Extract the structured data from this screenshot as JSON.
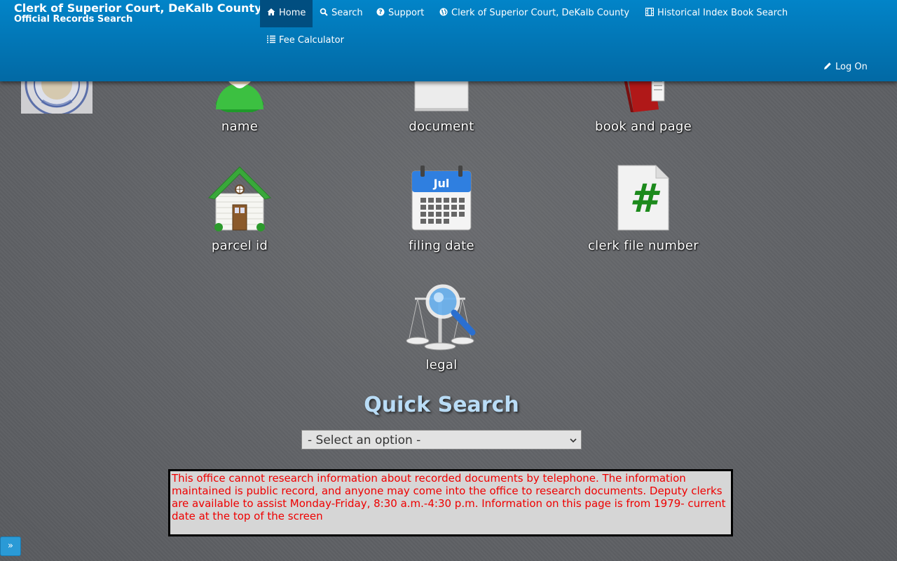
{
  "header": {
    "title": "Clerk of Superior Court, DeKalb County",
    "subtitle": "Official Records Search"
  },
  "nav": {
    "home": "Home",
    "search": "Search",
    "support": "Support",
    "clerk": "Clerk of Superior Court, DeKalb County",
    "historical": "Historical Index Book Search",
    "fee": "Fee Calculator",
    "logon": "Log On"
  },
  "tiles": {
    "name": "name",
    "document": "document",
    "book_page": "book and page",
    "parcel": "parcel id",
    "filing_date": "filing date",
    "clerk_file": "clerk file number",
    "legal": "legal",
    "calendar_month": "Jul",
    "hash_glyph": "#"
  },
  "quick_search": {
    "title": "Quick Search",
    "selected": "- Select an option -"
  },
  "notice": " This office cannot research information about recorded documents by telephone. The information maintained is public record, and anyone may come into the office to research documents. Deputy clerks are available to assist Monday-Friday, 8:30 a.m.-4:30 p.m. Information on this page is from 1979- current date at the top of the screen",
  "expand_label": "»",
  "colors": {
    "nav_top": "#0284c8",
    "nav_active": "#014e80",
    "notice_text": "#e00000",
    "quick_search_title": "#b9dcf6"
  },
  "icons": [
    "home-icon",
    "search-icon",
    "question-circle-icon",
    "globe-icon",
    "film-icon",
    "list-icon",
    "pencil-icon"
  ]
}
